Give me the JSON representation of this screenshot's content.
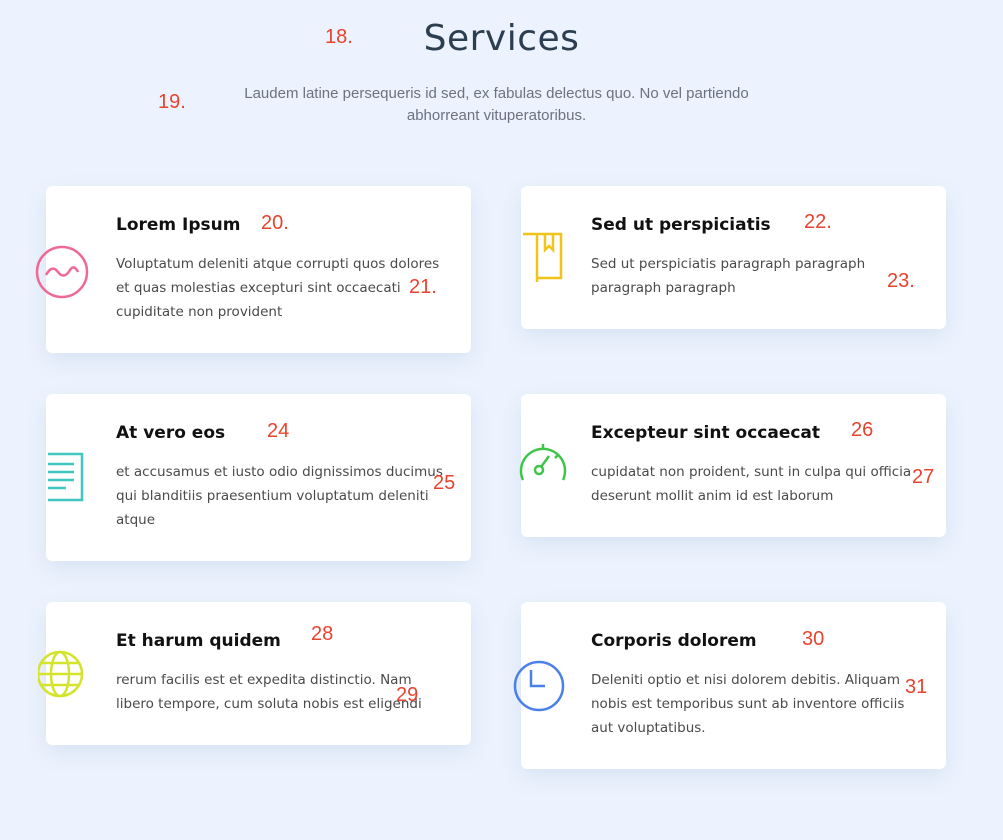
{
  "header": {
    "title": "Services",
    "subtitle": "Laudem latine persequeris id sed, ex fabulas delectus quo. No vel partiendo abhorreant vituperatoribus."
  },
  "markers": [
    "18.",
    "19.",
    "20.",
    "21.",
    "22.",
    "23.",
    "24",
    "25",
    "26",
    "27",
    "28",
    "29",
    "30",
    "31"
  ],
  "services": [
    {
      "title": "Lorem Ipsum",
      "text": "Voluptatum deleniti atque corrupti quos dolores et quas molestias excepturi sint occaecati cupiditate non provident",
      "icon": "wave-circle-icon",
      "color": "#f06896"
    },
    {
      "title": "Sed ut perspiciatis",
      "text": "Sed ut perspiciatis paragraph paragraph paragraph paragraph",
      "icon": "bookmark-book-icon",
      "color": "#f0c419"
    },
    {
      "title": "At vero eos",
      "text": "et accusamus et iusto odio dignissimos ducimus qui blanditiis praesentium voluptatum deleniti atque",
      "icon": "document-icon",
      "color": "#3ec8c0"
    },
    {
      "title": "Excepteur sint occaecat",
      "text": "cupidatat non proident, sunt in culpa qui officia deserunt mollit anim id est laborum",
      "icon": "speedometer-icon",
      "color": "#3ec64a"
    },
    {
      "title": "Et harum quidem",
      "text": "rerum facilis est et expedita distinctio. Nam libero tempore, cum soluta nobis est eligendi",
      "icon": "globe-icon",
      "color": "#d4e32c"
    },
    {
      "title": "Corporis dolorem",
      "text": "Deleniti optio et nisi dolorem debitis. Aliquam nobis est temporibus sunt ab inventore officiis aut voluptatibus.",
      "icon": "clock-icon",
      "color": "#4a80e8"
    }
  ]
}
